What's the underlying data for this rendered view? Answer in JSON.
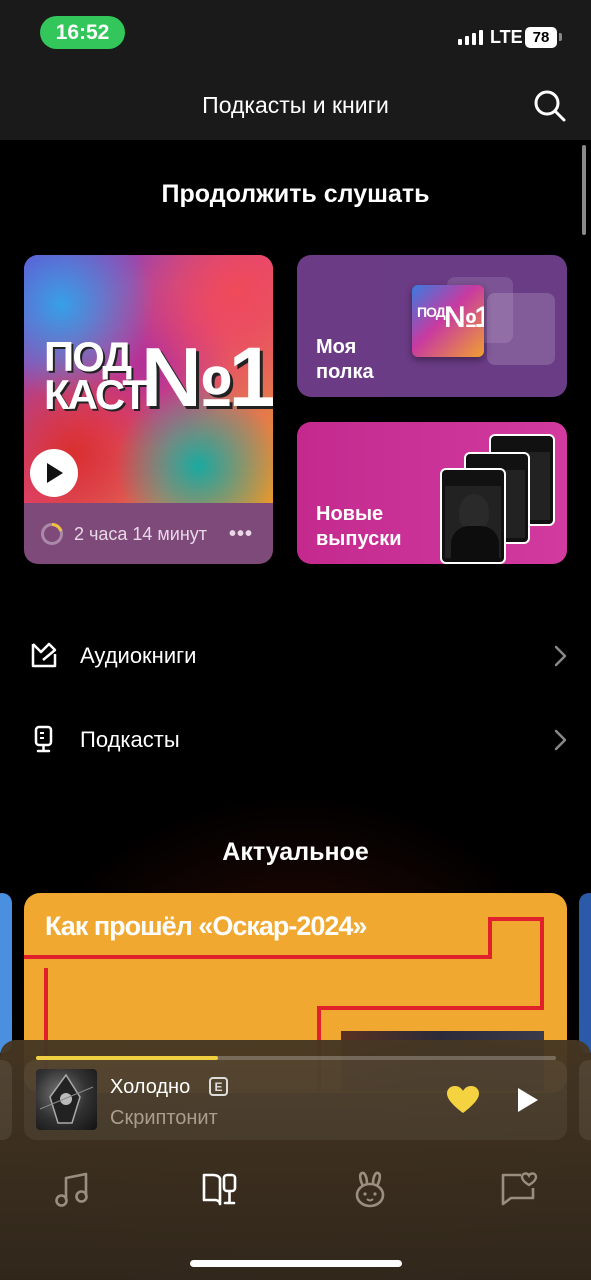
{
  "status_bar": {
    "time": "16:52",
    "network": "LTE",
    "battery": "78"
  },
  "header": {
    "title": "Подкасты и книги"
  },
  "continue": {
    "section_title": "Продолжить слушать",
    "card": {
      "cover_line1": "ПОД",
      "cover_line2": "КАСТ",
      "cover_number": "№1",
      "duration": "2 часа 14 минут",
      "more": "•••"
    },
    "shelf": {
      "line1": "Моя",
      "line2": "полка"
    },
    "new_releases": {
      "line1": "Новые",
      "line2": "выпуски"
    }
  },
  "categories": [
    {
      "label": "Аудиокниги",
      "icon": "audiobook-icon"
    },
    {
      "label": "Подкасты",
      "icon": "podcast-mic-icon"
    }
  ],
  "topical": {
    "section_title": "Актуальное",
    "banner_title": "Как прошёл «Оскар-2024»"
  },
  "player": {
    "title": "Холодно",
    "explicit": "E",
    "artist": "Скриптонит",
    "progress": 0.35,
    "liked": true,
    "like_color": "#f5d240"
  },
  "tabs": [
    {
      "name": "music",
      "icon": "music-note-icon",
      "active": false
    },
    {
      "name": "podcasts-books",
      "icon": "podcast-book-icon",
      "active": true
    },
    {
      "name": "kids",
      "icon": "bunny-icon",
      "active": false
    },
    {
      "name": "collection",
      "icon": "collection-heart-icon",
      "active": false
    }
  ],
  "colors": {
    "accent": "#f5d240",
    "status_green": "#33c65a",
    "shelf_tile": "#6b3c85",
    "new_tile": "#c42a8e",
    "topical_banner": "#f0a830"
  }
}
